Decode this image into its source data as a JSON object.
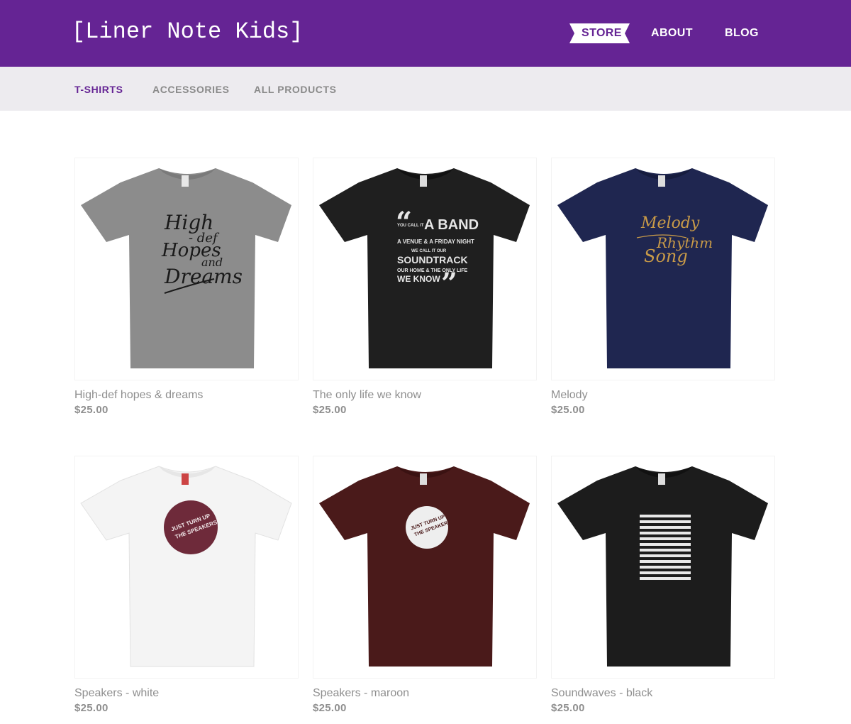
{
  "header": {
    "logo": "[Liner Note Kids]",
    "nav": [
      {
        "label": "STORE",
        "active": true
      },
      {
        "label": "ABOUT",
        "active": false
      },
      {
        "label": "BLOG",
        "active": false
      }
    ],
    "brand_color": "#652494"
  },
  "subnav": {
    "items": [
      {
        "label": "T-SHIRTS",
        "active": true
      },
      {
        "label": "ACCESSORIES",
        "active": false
      },
      {
        "label": "ALL PRODUCTS",
        "active": false
      }
    ]
  },
  "products": [
    {
      "name": "High-def hopes & dreams",
      "price": "$25.00",
      "shirt_color": "#8c8c8c",
      "print": "script-hopes"
    },
    {
      "name": "The only life we know",
      "price": "$25.00",
      "shirt_color": "#1f1f1f",
      "print": "band-quote"
    },
    {
      "name": "Melody",
      "price": "$25.00",
      "shirt_color": "#1f2650",
      "print": "melody-gold"
    },
    {
      "name": "Speakers - white",
      "price": "$25.00",
      "shirt_color": "#f4f4f4",
      "print": "speakers-maroon"
    },
    {
      "name": "Speakers - maroon",
      "price": "$25.00",
      "shirt_color": "#4a1a1a",
      "print": "speakers-white"
    },
    {
      "name": "Soundwaves - black",
      "price": "$25.00",
      "shirt_color": "#1c1c1c",
      "print": "soundwaves"
    }
  ],
  "print_text": {
    "hopes": [
      "High",
      "- def",
      "Hopes",
      "and",
      "Dreams"
    ],
    "band": [
      "YOU CALL IT",
      "A BAND",
      "A VENUE & A FRIDAY NIGHT",
      "WE CALL IT OUR",
      "SOUNDTRACK",
      "OUR HOME & THE ONLY LIFE",
      "WE KNOW"
    ],
    "melody": [
      "Melody",
      "Rhythm",
      "Song"
    ],
    "speakers": [
      "JUST TURN UP",
      "THE SPEAKERS"
    ]
  }
}
